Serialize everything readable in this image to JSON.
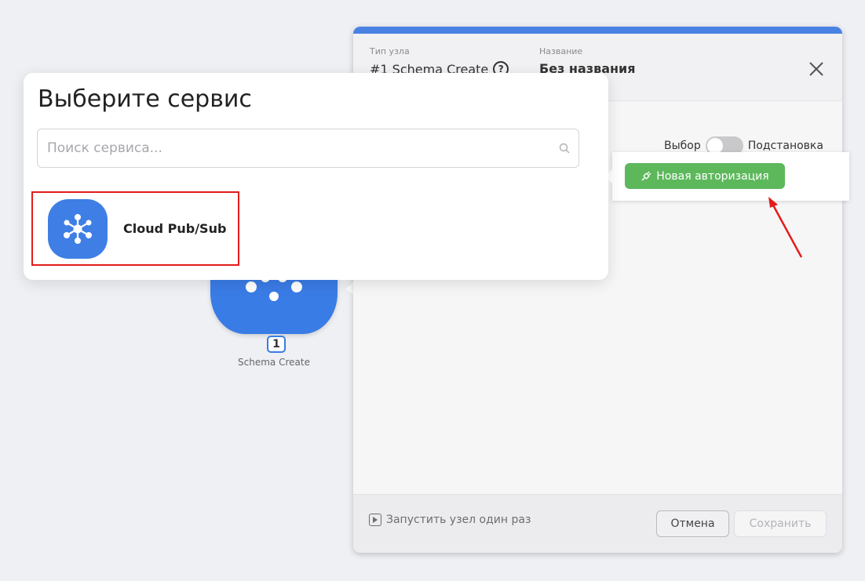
{
  "canvas": {
    "node_number": "1",
    "node_label": "Schema Create"
  },
  "panel": {
    "node_type_label": "Тип узла",
    "node_type_value": "#1 Schema Create",
    "help_glyph": "?",
    "separator": "/",
    "name_label": "Название",
    "name_value": "Без названия",
    "toggle_left_label": "Выбор",
    "toggle_right_label": "Подстановка",
    "auth_button_label": "Новая авторизация",
    "run_once_label": "Запустить узел один раз",
    "cancel_label": "Отмена",
    "save_label": "Сохранить"
  },
  "chooser": {
    "title": "Выберите сервис",
    "search_placeholder": "Поиск сервиса...",
    "search_value": "",
    "services": [
      {
        "label": "Cloud Pub/Sub",
        "icon": "pubsub-hub-icon"
      }
    ]
  },
  "colors": {
    "accent_blue": "#3a7ce6",
    "top_bar": "#4a82e4",
    "auth_green": "#5db85c",
    "highlight_red": "#e31b1b"
  }
}
